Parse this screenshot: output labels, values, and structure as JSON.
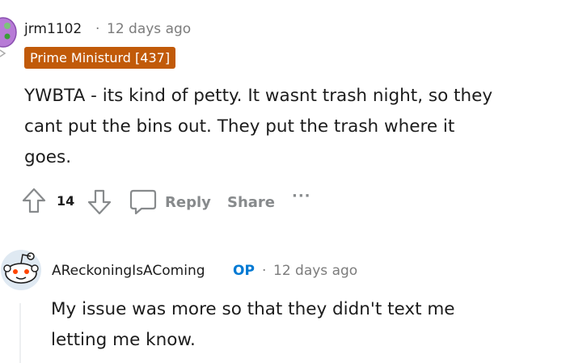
{
  "comment1": {
    "username": "jrm1102",
    "separator": "·",
    "time": "12 days ago",
    "flair": "Prime Ministurd [437]",
    "body_lines": [
      "YWBTA - its kind of petty. It wasnt trash night, so they",
      "cant put the bins out. They put the trash where it",
      "goes."
    ],
    "votes": "14",
    "reply_label": "Reply",
    "share_label": "Share",
    "more_label": "···"
  },
  "comment2": {
    "username": "AReckoningIsAComing",
    "op_badge": "OP",
    "separator": "·",
    "time": "12 days ago",
    "body_lines": [
      "My issue was more so that they didn't text me",
      "letting me know."
    ]
  },
  "colors": {
    "flair_bg": "#c15a09",
    "op_blue": "#0079d3",
    "meta_gray": "#7c7c7c",
    "action_gray": "#878a8c"
  },
  "icons": [
    "avatar-purple-snoo",
    "upvote-arrow-icon",
    "downvote-arrow-icon",
    "comment-bubble-icon",
    "avatar-snoo"
  ]
}
